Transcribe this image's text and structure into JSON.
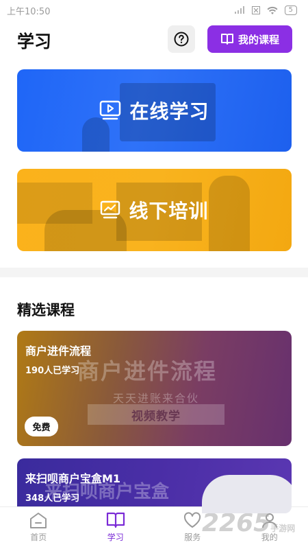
{
  "status_bar": {
    "time": "上午10:50",
    "battery": "5"
  },
  "header": {
    "title": "学习",
    "my_courses_label": "我的课程"
  },
  "banners": {
    "online_label": "在线学习",
    "offline_label": "线下培训"
  },
  "section": {
    "title": "精选课程"
  },
  "courses": [
    {
      "title": "商户进件流程",
      "learners": "190人已学习",
      "badge": "免费",
      "art_title": "商户进件流程",
      "art_subtitle": "天天进账来合伙",
      "art_ribbon": "视频教学"
    },
    {
      "title": "来扫呗商户宝盒M1",
      "learners": "348人已学习",
      "art_title": "来扫呗商户宝盒"
    }
  ],
  "tabs": [
    {
      "label": "首页",
      "icon": "home-icon"
    },
    {
      "label": "学习",
      "icon": "book-icon"
    },
    {
      "label": "服务",
      "icon": "heart-icon"
    },
    {
      "label": "我的",
      "icon": "user-icon"
    }
  ],
  "watermark": {
    "text": "2265",
    "sub": "手游网"
  },
  "colors": {
    "accent": "#8b2fe4",
    "online_banner": "#1f66f7",
    "offline_banner": "#fbb21b",
    "tab_active": "#7a2ad6",
    "tab_inactive": "#9a9a9a"
  }
}
